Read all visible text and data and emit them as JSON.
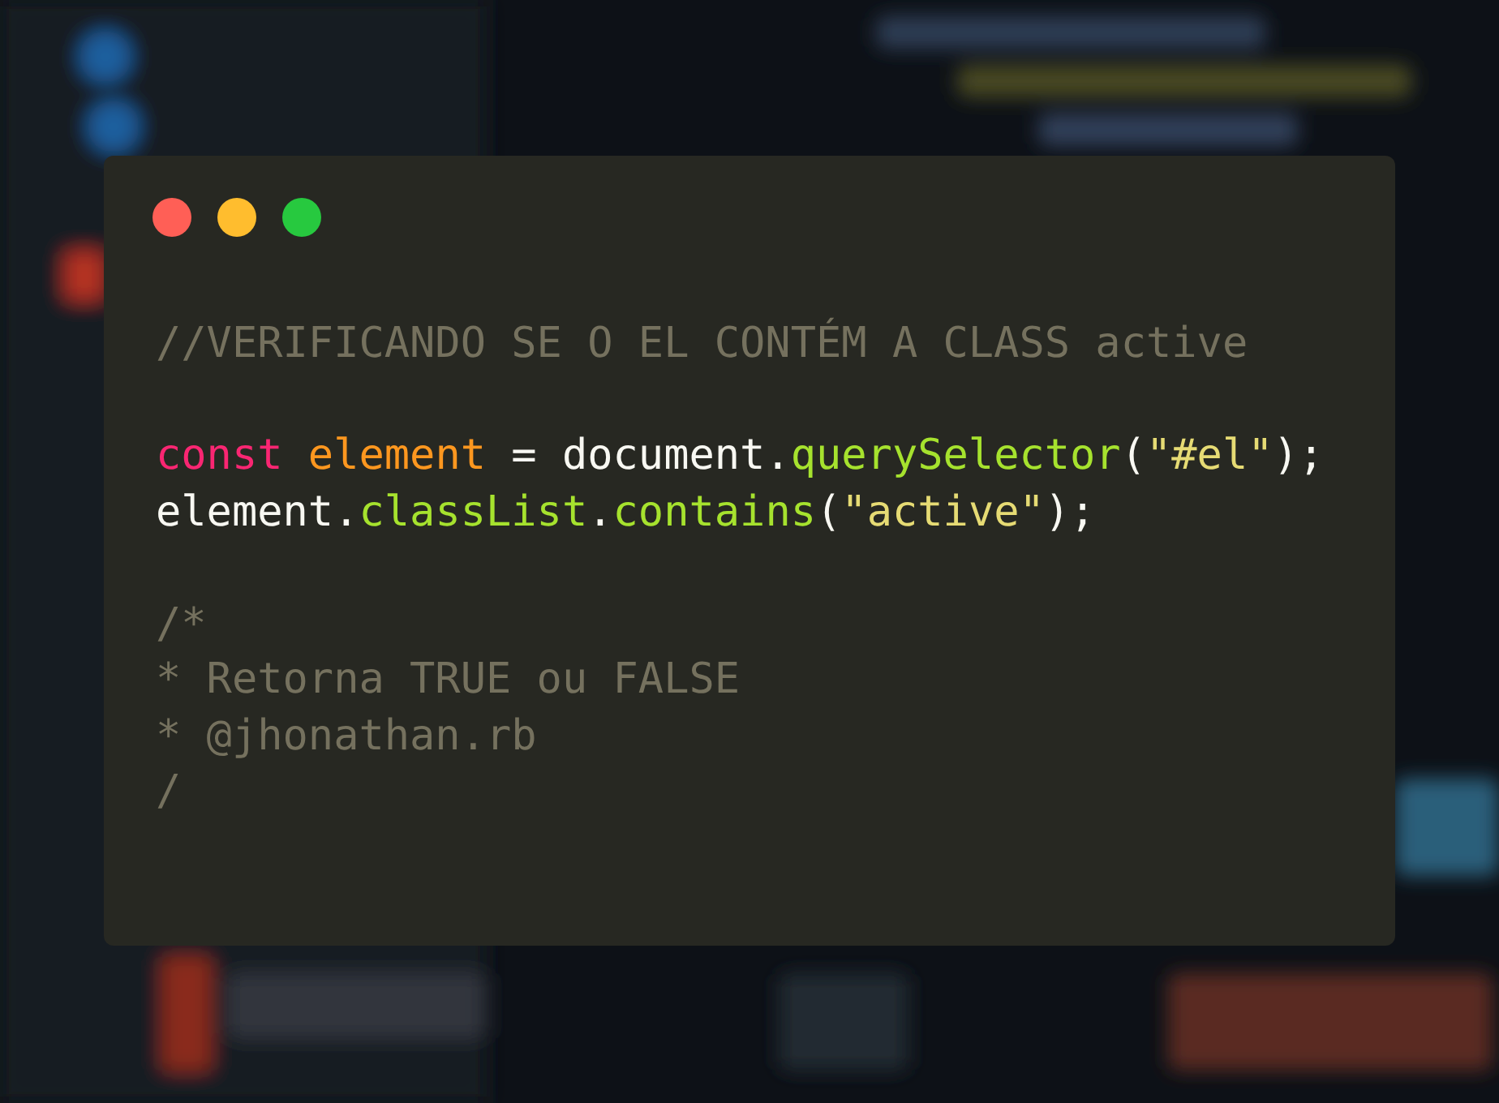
{
  "code_window": {
    "lines": [
      {
        "kind": "code",
        "tokens": [
          {
            "kind": "comment",
            "text": "//VERIFICANDO SE O EL CONTÉM A CLASS active"
          }
        ]
      },
      {
        "kind": "blank"
      },
      {
        "kind": "code",
        "tokens": [
          {
            "kind": "keyword",
            "text": "const "
          },
          {
            "kind": "variable",
            "text": "element"
          },
          {
            "kind": "plain",
            "text": " = document."
          },
          {
            "kind": "method",
            "text": "querySelector"
          },
          {
            "kind": "plain",
            "text": "("
          },
          {
            "kind": "string",
            "text": "\"#el\""
          },
          {
            "kind": "plain",
            "text": ");"
          }
        ]
      },
      {
        "kind": "code",
        "tokens": [
          {
            "kind": "plain",
            "text": "element."
          },
          {
            "kind": "method",
            "text": "classList"
          },
          {
            "kind": "plain",
            "text": "."
          },
          {
            "kind": "method",
            "text": "contains"
          },
          {
            "kind": "plain",
            "text": "("
          },
          {
            "kind": "string",
            "text": "\"active\""
          },
          {
            "kind": "plain",
            "text": ");"
          }
        ]
      },
      {
        "kind": "blank"
      },
      {
        "kind": "code",
        "tokens": [
          {
            "kind": "comment",
            "text": "/*"
          }
        ]
      },
      {
        "kind": "code",
        "tokens": [
          {
            "kind": "comment",
            "text": "* Retorna TRUE ou FALSE"
          }
        ]
      },
      {
        "kind": "code",
        "tokens": [
          {
            "kind": "comment",
            "text": "* @jhonathan.rb"
          }
        ]
      },
      {
        "kind": "code",
        "tokens": [
          {
            "kind": "comment",
            "text": "/"
          }
        ]
      }
    ]
  }
}
